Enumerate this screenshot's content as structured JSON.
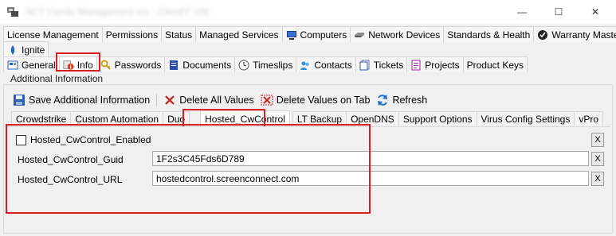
{
  "window": {
    "title": "ACT Family Management Inc - ClientIT 100",
    "min_glyph": "—",
    "max_glyph": "☐",
    "close_glyph": "✕"
  },
  "main_tabs_row1": [
    {
      "label": "License Management",
      "icon": ""
    },
    {
      "label": "Permissions",
      "icon": ""
    },
    {
      "label": "Status",
      "icon": ""
    },
    {
      "label": "Managed Services",
      "icon": ""
    },
    {
      "label": "Computers",
      "icon": "computer-icon"
    },
    {
      "label": "Network Devices",
      "icon": "network-device-icon"
    },
    {
      "label": "Standards & Health",
      "icon": ""
    },
    {
      "label": "Warranty Master™",
      "icon": "warranty-icon"
    }
  ],
  "main_tabs_row2": [
    {
      "label": "Ignite",
      "icon": "ignite-icon"
    }
  ],
  "main_tabs_row3": [
    {
      "label": "General",
      "icon": "general-icon"
    },
    {
      "label": "Info",
      "icon": "info-icon",
      "active": true
    },
    {
      "label": "Passwords",
      "icon": "key-icon"
    },
    {
      "label": "Documents",
      "icon": "document-icon"
    },
    {
      "label": "Timeslips",
      "icon": "clock-icon"
    },
    {
      "label": "Contacts",
      "icon": "contacts-icon"
    },
    {
      "label": "Tickets",
      "icon": "tickets-icon"
    },
    {
      "label": "Projects",
      "icon": "projects-icon"
    },
    {
      "label": "Product Keys",
      "icon": ""
    }
  ],
  "group_label": "Additional Information",
  "toolbar": {
    "save": "Save Additional Information",
    "delete_all": "Delete All Values",
    "delete_on_tab": "Delete Values on Tab",
    "refresh": "Refresh"
  },
  "sub_tabs": [
    {
      "label": "Crowdstrike"
    },
    {
      "label": "Custom Automation"
    },
    {
      "label": "Duo"
    },
    {
      "label": "Hosted_CwControl",
      "active": true
    },
    {
      "label": "LT Backup"
    },
    {
      "label": "OpenDNS"
    },
    {
      "label": "Support Options"
    },
    {
      "label": "Virus Config Settings"
    },
    {
      "label": "vPro"
    }
  ],
  "fields": {
    "enabled_label": "Hosted_CwControl_Enabled",
    "enabled_checked": false,
    "guid_label": "Hosted_CwControl_Guid",
    "guid_value": "1F2s3C45Fds6D789",
    "url_label": "Hosted_CwControl_URL",
    "url_value": "hostedcontrol.screenconnect.com",
    "clear_glyph": "X"
  },
  "colors": {
    "highlight": "#d62020",
    "delete_red": "#cc2222",
    "refresh_blue": "#1a6fd1"
  }
}
